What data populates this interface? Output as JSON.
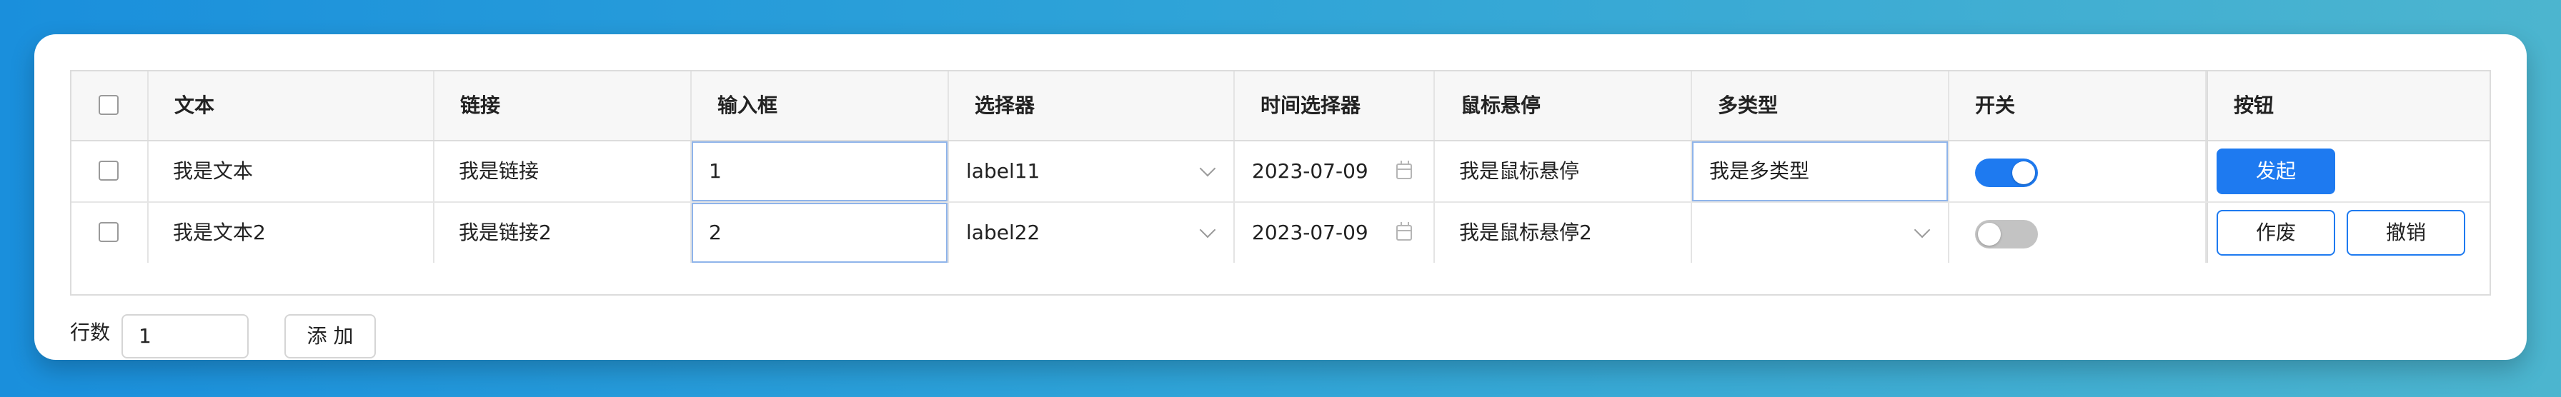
{
  "table": {
    "columns": [
      "文本",
      "链接",
      "输入框",
      "选择器",
      "时间选择器",
      "鼠标悬停",
      "多类型",
      "开关",
      "按钮"
    ],
    "rows": [
      {
        "text": "我是文本",
        "link": "我是链接",
        "input": "1",
        "select": "label11",
        "date": "2023-07-09",
        "hover": "我是鼠标悬停",
        "multi": "我是多类型",
        "switch_on": true,
        "buttons": [
          "发起"
        ]
      },
      {
        "text": "我是文本2",
        "link": "我是链接2",
        "input": "2",
        "select": "label22",
        "date": "2023-07-09",
        "hover": "我是鼠标悬停2",
        "multi": "",
        "switch_on": false,
        "buttons": [
          "作废",
          "撤销"
        ]
      }
    ]
  },
  "footer": {
    "rows_label": "行数",
    "rows_value": "1",
    "add_label": "添 加"
  },
  "icons": {
    "dropdown": "chevron-down-icon",
    "date": "calendar-icon"
  },
  "colors": {
    "primary": "#1e7af0",
    "switch_off": "#c3c3c3",
    "input_border_focus": "#8fb4ea"
  }
}
